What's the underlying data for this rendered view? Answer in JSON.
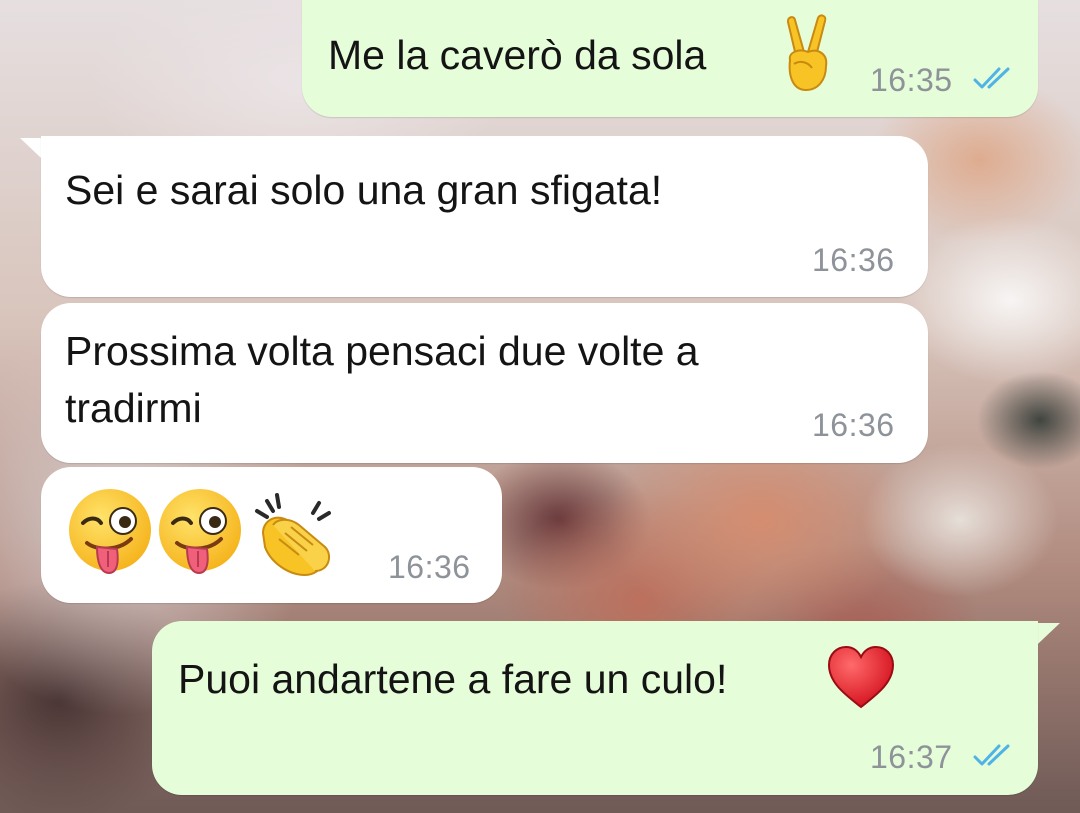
{
  "chat": {
    "messages": [
      {
        "direction": "outgoing",
        "text": "Me la caverò da sola",
        "emoji": "victory-hand",
        "time": "16:35",
        "status": "read"
      },
      {
        "direction": "incoming",
        "text": "Sei e sarai solo una gran sfigata!",
        "time": "16:36"
      },
      {
        "direction": "incoming",
        "text": "Prossima volta pensaci due volte a\ntradirmi",
        "time": "16:36"
      },
      {
        "direction": "incoming",
        "emoji": [
          "winking-face-with-tongue",
          "winking-face-with-tongue",
          "clapping-hands"
        ],
        "time": "16:36"
      },
      {
        "direction": "outgoing",
        "text": "Puoi andartene a fare un culo!",
        "emoji": "red-heart",
        "time": "16:37",
        "status": "read"
      }
    ]
  },
  "colors": {
    "incoming_bubble": "#ffffff",
    "outgoing_bubble": "#e6fdd9",
    "timestamp": "#8d9399",
    "read_ticks": "#4fb3e6"
  }
}
